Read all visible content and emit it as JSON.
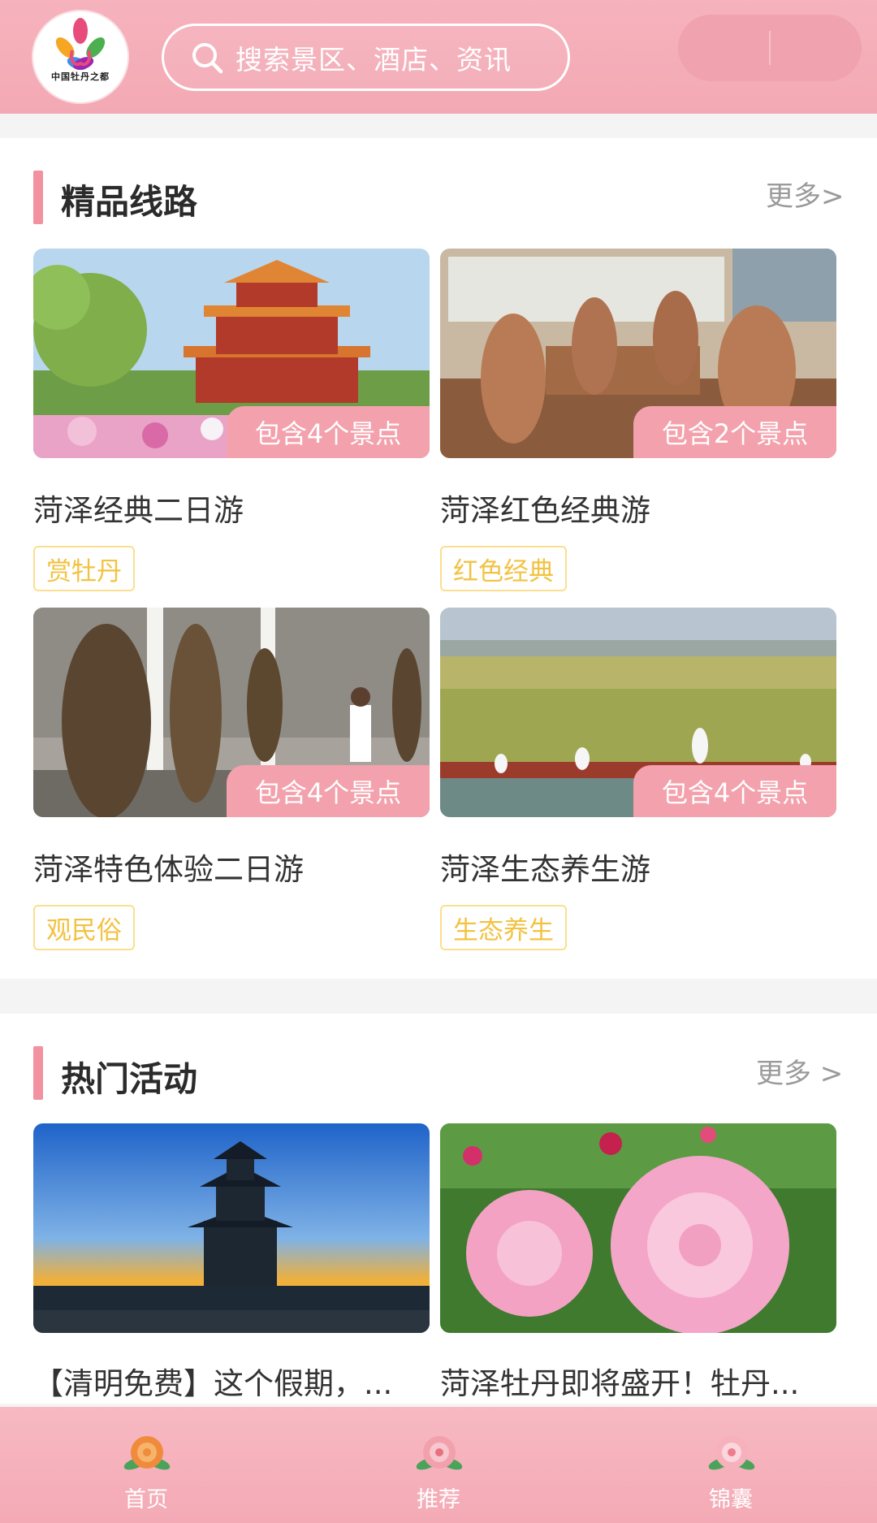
{
  "header": {
    "logo_caption": "中国牡丹之都",
    "search_placeholder": "搜索景区、酒店、资讯"
  },
  "routes": {
    "title": "精品线路",
    "more": "更多>",
    "cards": [
      {
        "title": "菏泽经典二日游",
        "spots": "包含4个景点",
        "tag": "赏牡丹"
      },
      {
        "title": "菏泽红色经典游",
        "spots": "包含2个景点",
        "tag": "红色经典"
      },
      {
        "title": "菏泽特色体验二日游",
        "spots": "包含4个景点",
        "tag": "观民俗"
      },
      {
        "title": "菏泽生态养生游",
        "spots": "包含4个景点",
        "tag": "生态养生"
      }
    ]
  },
  "activities": {
    "title": "热门活动",
    "more": "更多 >",
    "cards": [
      {
        "title": "【清明免费】这个假期，..."
      },
      {
        "title": "菏泽牡丹即将盛开！牡丹..."
      }
    ]
  },
  "tabbar": {
    "items": [
      {
        "label": "首页",
        "icon": "peony-home-icon"
      },
      {
        "label": "推荐",
        "icon": "peony-recommend-icon"
      },
      {
        "label": "锦囊",
        "icon": "peony-tips-icon"
      }
    ]
  },
  "colors": {
    "header": "#f3a9b4",
    "accent": "#f2919f",
    "tag_border": "#fbdf8e",
    "tag_text": "#f2c241"
  }
}
